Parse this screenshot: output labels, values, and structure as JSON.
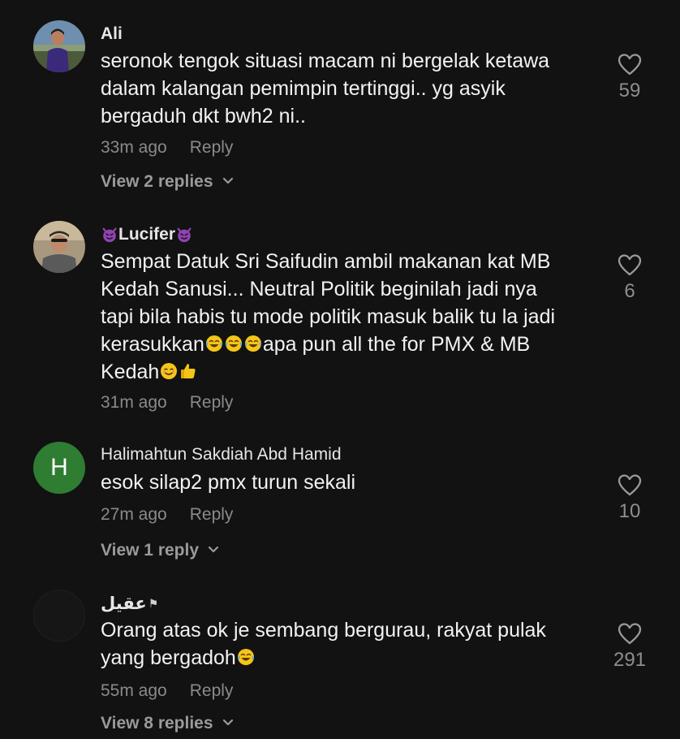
{
  "comments": [
    {
      "username": "Ali",
      "lines": [
        "seronok tengok situasi macam ni bergelak ketawa",
        "dalam kalangan pemimpin tertinggi.. yg asyik",
        "bergaduh dkt bwh2 ni.."
      ],
      "time": "33m ago",
      "reply_label": "Reply",
      "likes": "59",
      "view_replies": "View 2 replies"
    },
    {
      "username": "Lucifer",
      "lines": [
        "Sempat Datuk Sri Saifudin ambil makanan kat MB",
        "Kedah Sanusi... Neutral Politik beginilah jadi nya",
        "tapi bila habis tu mode politik masuk balik tu la jadi",
        "kerasukkan",
        "apa pun all the for PMX & MB",
        "Kedah"
      ],
      "time": "31m ago",
      "reply_label": "Reply",
      "likes": "6"
    },
    {
      "username": "Halimahtun Sakdiah Abd Hamid",
      "avatar_letter": "H",
      "lines": [
        "esok silap2 pmx turun sekali"
      ],
      "time": "27m ago",
      "reply_label": "Reply",
      "likes": "10",
      "view_replies": "View 1 reply"
    },
    {
      "username": "عقيل",
      "lines": [
        "Orang atas ok je sembang bergurau, rakyat pulak",
        "yang bergadoh"
      ],
      "time": "55m ago",
      "reply_label": "Reply",
      "likes": "291",
      "view_replies": "View 8 replies"
    }
  ],
  "colors": {
    "background": "#121212",
    "text": "#f2f2f2",
    "muted": "#8a8a8a",
    "avatar_h": "#2e7d32",
    "emoji_purple": "#8e44ad",
    "emoji_yellow": "#f5c518"
  },
  "icons": [
    "heart-icon",
    "chevron-down-icon",
    "devil-emoji",
    "rofl-emoji",
    "smile-emoji",
    "thumbs-up-emoji"
  ]
}
